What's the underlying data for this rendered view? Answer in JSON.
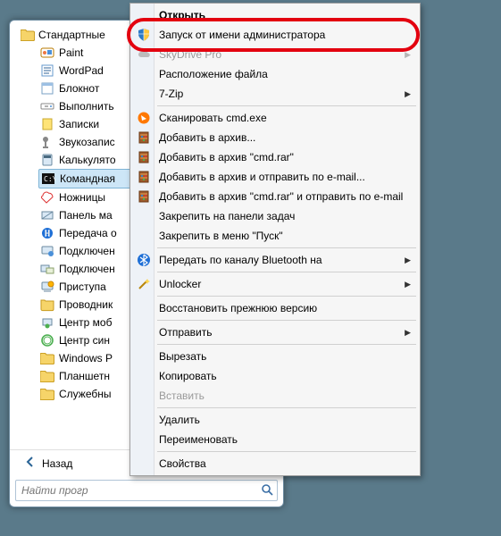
{
  "tree": {
    "root_label": "Стандартные",
    "items": [
      "Paint",
      "WordPad",
      "Блокнот",
      "Выполнить",
      "Записки",
      "Звукозапис",
      "Калькулято",
      "Командная",
      "Ножницы",
      "Панель ма",
      "Передача о",
      "Подключен",
      "Подключен",
      "Приступа",
      "Проводник",
      "Центр моб",
      "Центр син",
      "Windows P",
      "Планшетн",
      "Служебны"
    ],
    "selected_index": 7
  },
  "back_label": "Назад",
  "search_placeholder": "Найти прогр",
  "menu": {
    "items": [
      {
        "label": "Открыть",
        "icon": "",
        "bold": true
      },
      {
        "label": "Запуск от имени администратора",
        "icon": "shield",
        "highlight": true
      },
      {
        "label": "SkyDrive Pro",
        "icon": "cloud",
        "arrow": true,
        "disabled": true
      },
      {
        "label": "Расположение файла",
        "icon": ""
      },
      {
        "label": "7-Zip",
        "icon": "",
        "arrow": true
      },
      {
        "sep": true
      },
      {
        "label": "Сканировать cmd.exe",
        "icon": "avast"
      },
      {
        "label": "Добавить в архив...",
        "icon": "winrar"
      },
      {
        "label": "Добавить в архив \"cmd.rar\"",
        "icon": "winrar"
      },
      {
        "label": "Добавить в архив и отправить по e-mail...",
        "icon": "winrar"
      },
      {
        "label": "Добавить в архив \"cmd.rar\" и отправить по e-mail",
        "icon": "winrar"
      },
      {
        "label": "Закрепить на панели задач",
        "icon": ""
      },
      {
        "label": "Закрепить в меню \"Пуск\"",
        "icon": ""
      },
      {
        "sep": true
      },
      {
        "label": "Передать по каналу Bluetooth на",
        "icon": "bluetooth",
        "arrow": true
      },
      {
        "sep": true
      },
      {
        "label": "Unlocker",
        "icon": "wand",
        "arrow": true
      },
      {
        "sep": true
      },
      {
        "label": "Восстановить прежнюю версию",
        "icon": ""
      },
      {
        "sep": true
      },
      {
        "label": "Отправить",
        "icon": "",
        "arrow": true
      },
      {
        "sep": true
      },
      {
        "label": "Вырезать",
        "icon": ""
      },
      {
        "label": "Копировать",
        "icon": ""
      },
      {
        "label": "Вставить",
        "icon": "",
        "disabled": true
      },
      {
        "sep": true
      },
      {
        "label": "Удалить",
        "icon": ""
      },
      {
        "label": "Переименовать",
        "icon": ""
      },
      {
        "sep": true
      },
      {
        "label": "Свойства",
        "icon": ""
      }
    ]
  }
}
